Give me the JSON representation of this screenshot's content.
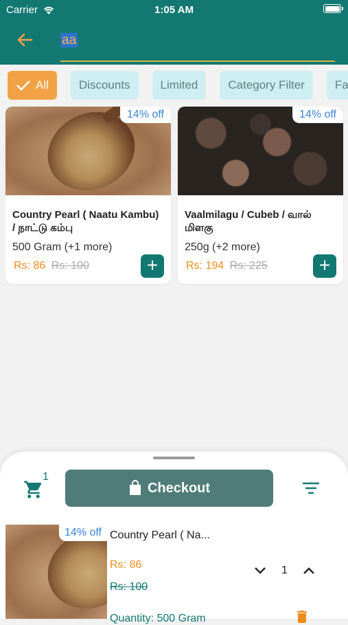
{
  "status": {
    "carrier": "Carrier",
    "time": "1:05 AM"
  },
  "header": {
    "search_value": "aa"
  },
  "chips": [
    "All",
    "Discounts",
    "Limited",
    "Category Filter",
    "Fa"
  ],
  "products": [
    {
      "badge": "14% off",
      "name": "Country Pearl ( Naatu Kambu) / நாட்டு கம்பு",
      "qty": "500 Gram  (+1 more)",
      "price": "Rs: 86",
      "old_price": "Rs: 100"
    },
    {
      "badge": "14% off",
      "name": "Vaalmilagu / Cubeb / வால் மிளகு",
      "qty": "250g  (+2 more)",
      "price": "Rs: 194",
      "old_price": "Rs: 225"
    }
  ],
  "cart": {
    "count": "1",
    "checkout_label": "Checkout",
    "item": {
      "badge": "14% off",
      "name": "Country Pearl ( Na...",
      "price": "Rs: 86",
      "old_price": "Rs: 100",
      "quantity_count": "1",
      "quantity_label": "Quantity: 500 Gram"
    }
  },
  "colors": {
    "primary": "#137872",
    "accent": "#f2a144",
    "discount": "#3a84d6",
    "price": "#f08c1b"
  },
  "icons": [
    "wifi-icon",
    "battery-icon",
    "back-arrow-icon",
    "check-icon",
    "plus-icon",
    "cart-icon",
    "bag-icon",
    "filter-icon",
    "chevron-down-icon",
    "chevron-up-icon",
    "trash-icon"
  ]
}
